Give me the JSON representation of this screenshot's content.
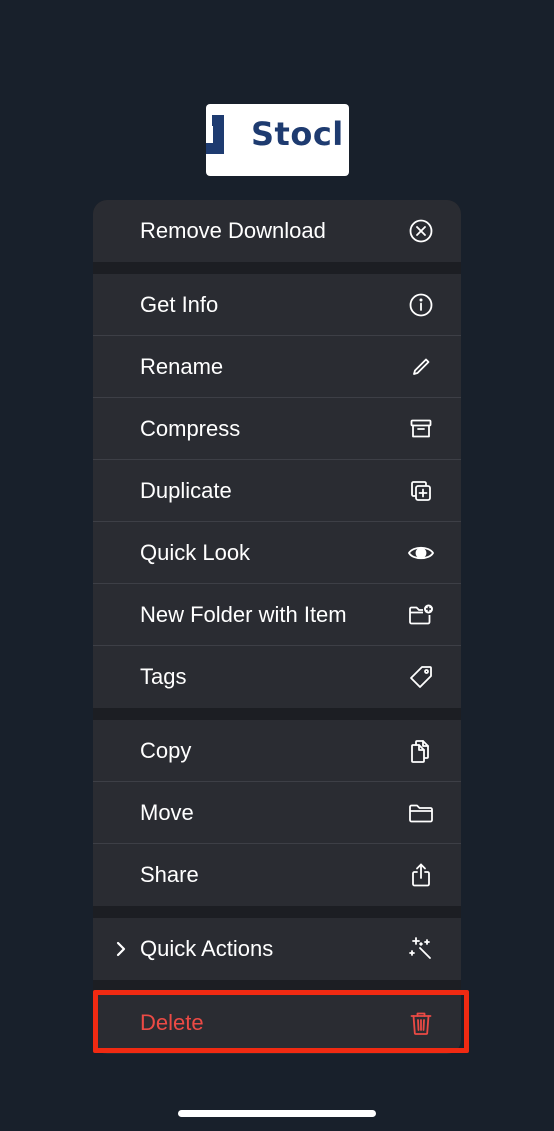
{
  "thumbnail": {
    "text": "Stocl",
    "brand_color": "#1e3b70"
  },
  "menu": {
    "remove_download": {
      "label": "Remove Download",
      "icon": "x-circle-icon"
    },
    "get_info": {
      "label": "Get Info",
      "icon": "info-circle-icon"
    },
    "rename": {
      "label": "Rename",
      "icon": "pencil-icon"
    },
    "compress": {
      "label": "Compress",
      "icon": "archive-box-icon"
    },
    "duplicate": {
      "label": "Duplicate",
      "icon": "duplicate-plus-icon"
    },
    "quick_look": {
      "label": "Quick Look",
      "icon": "eye-icon"
    },
    "new_folder": {
      "label": "New Folder with Item",
      "icon": "folder-plus-icon"
    },
    "tags": {
      "label": "Tags",
      "icon": "tag-icon"
    },
    "copy": {
      "label": "Copy",
      "icon": "copy-document-icon"
    },
    "move": {
      "label": "Move",
      "icon": "folder-icon"
    },
    "share": {
      "label": "Share",
      "icon": "share-icon"
    },
    "quick_actions": {
      "label": "Quick Actions",
      "icon": "sparkles-wand-icon"
    },
    "delete": {
      "label": "Delete",
      "icon": "trash-icon",
      "color": "#eb4a45"
    }
  },
  "highlight_color": "#f02a12"
}
